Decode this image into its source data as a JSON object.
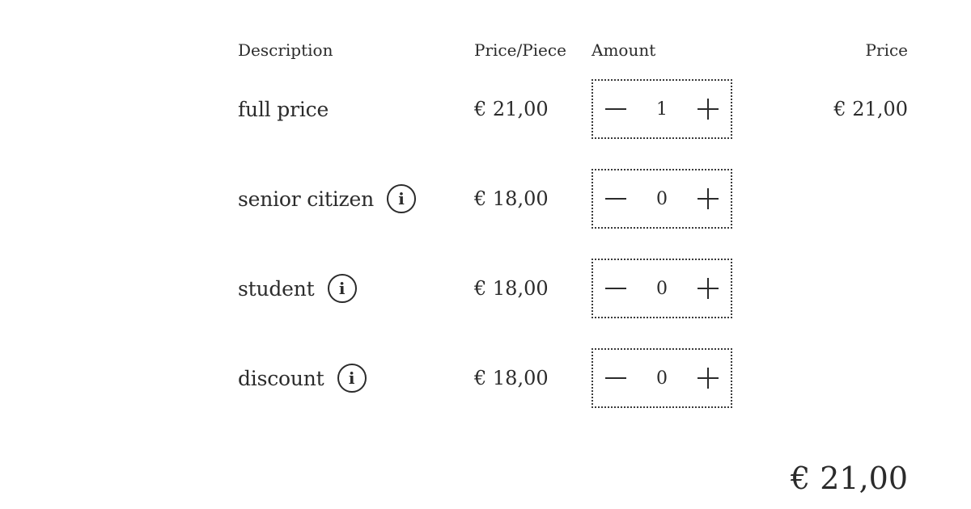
{
  "headers": {
    "description": "Description",
    "price_per_piece": "Price/Piece",
    "amount": "Amount",
    "price": "Price"
  },
  "rows": [
    {
      "description": "full price",
      "price_per_piece": "€ 21,00",
      "amount": "1",
      "price": "€ 21,00",
      "has_info": false
    },
    {
      "description": "senior citizen",
      "price_per_piece": "€ 18,00",
      "amount": "0",
      "price": "",
      "has_info": true
    },
    {
      "description": "student",
      "price_per_piece": "€ 18,00",
      "amount": "0",
      "price": "",
      "has_info": true
    },
    {
      "description": "discount",
      "price_per_piece": "€ 18,00",
      "amount": "0",
      "price": "",
      "has_info": true
    }
  ],
  "info_glyph": "i",
  "total": "€ 21,00",
  "icons": {
    "info": "info-icon",
    "decrement": "minus-icon",
    "increment": "plus-icon"
  }
}
